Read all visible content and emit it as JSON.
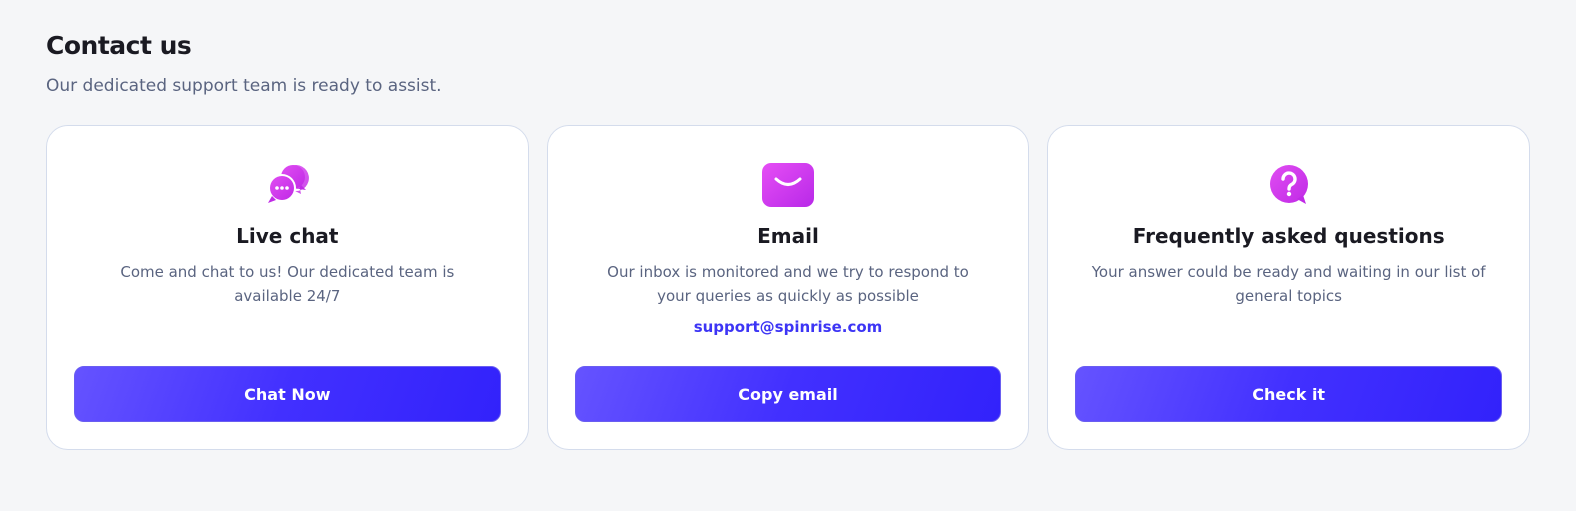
{
  "header": {
    "title": "Contact us",
    "subtitle": "Our dedicated support team is ready to assist."
  },
  "cards": [
    {
      "icon": "chat-bubbles-icon",
      "title": "Live chat",
      "description": "Come and chat to us! Our dedicated team is available 24/7",
      "button_label": "Chat Now"
    },
    {
      "icon": "envelope-icon",
      "title": "Email",
      "description": "Our inbox is monitored and we try to respond to your queries as quickly as possible",
      "email": "support@spinrise.com",
      "button_label": "Copy email"
    },
    {
      "icon": "question-bubble-icon",
      "title": "Frequently asked questions",
      "description": "Your answer could be ready and waiting in our list of general topics",
      "button_label": "Check it"
    }
  ],
  "colors": {
    "background": "#f5f6f8",
    "accent_blue": "#3d35f5",
    "icon_magenta": "#d633f0",
    "button_gradient_start": "#6553ff",
    "button_gradient_end": "#3222fb"
  }
}
